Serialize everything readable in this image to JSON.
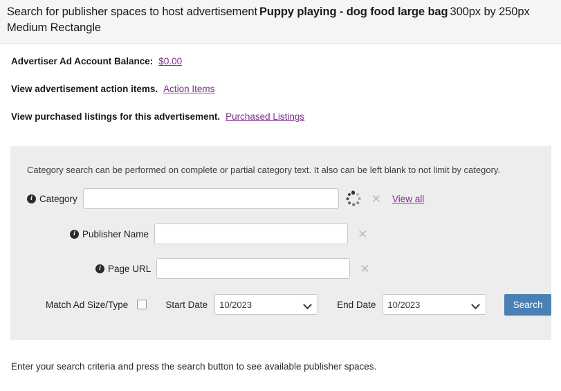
{
  "header": {
    "prefix": "Search for publisher spaces to host advertisement",
    "ad_name": "Puppy playing - dog food large bag",
    "ad_size": "300px by 250px Medium Rectangle"
  },
  "info": {
    "balance_label": "Advertiser Ad Account Balance:",
    "balance_link": "$0.00",
    "action_items_label": "View advertisement action items.",
    "action_items_link": "Action Items",
    "purchased_label": "View purchased listings for this advertisement.",
    "purchased_link": "Purchased Listings"
  },
  "panel": {
    "note": "Category search can be performed on complete or partial category text. It also can be left blank to not limit by category.",
    "category": {
      "label": "Category",
      "value": "",
      "placeholder": "",
      "clear_icon": "✕",
      "view_all": "View all"
    },
    "publisher": {
      "label": "Publisher Name",
      "value": "",
      "placeholder": "",
      "clear_icon": "✕"
    },
    "page_url": {
      "label": "Page URL",
      "value": "",
      "placeholder": "",
      "clear_icon": "✕"
    },
    "match_ad": {
      "label": "Match Ad Size/Type",
      "checked": false
    },
    "start_date": {
      "label": "Start Date",
      "value": "10/2023",
      "options": [
        "10/2023"
      ]
    },
    "end_date": {
      "label": "End Date",
      "value": "10/2023",
      "options": [
        "10/2023"
      ]
    },
    "search_button": "Search"
  },
  "footer": {
    "note": "Enter your search criteria and press the search button to see available publisher spaces."
  },
  "colors": {
    "link": "#7b2f8e",
    "button": "#4a81b4",
    "panel_bg": "#ededed",
    "header_bg": "#f5f5f5"
  },
  "icons": {
    "info": "i",
    "spinner": "loading-spinner-icon"
  }
}
